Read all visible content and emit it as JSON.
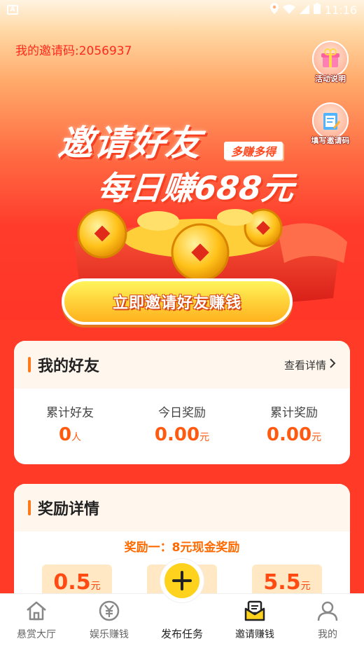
{
  "status_bar": {
    "time": "11:16"
  },
  "hero": {
    "invite_code": "我的邀请码:2056937",
    "side_buttons": [
      {
        "label": "活动说明",
        "icon": "gift-icon"
      },
      {
        "label": "填写邀请码",
        "icon": "clipboard-edit-icon"
      }
    ],
    "headline_line1": "邀请好友",
    "headline_tag": "多赚多得",
    "headline_line2": "每日赚688元",
    "invite_button": "立即邀请好友赚钱"
  },
  "friends_card": {
    "title": "我的好友",
    "more": "查看详情",
    "stats": [
      {
        "label": "累计好友",
        "value": "0",
        "unit": "人"
      },
      {
        "label": "今日奖励",
        "value": "0.00",
        "unit": "元"
      },
      {
        "label": "累计奖励",
        "value": "0.00",
        "unit": "元"
      }
    ]
  },
  "reward_card": {
    "title": "奖励详情",
    "subtitle_prefix": "奖励一：",
    "subtitle_highlight": "8元现金奖励",
    "tickets": [
      {
        "value": "0.5",
        "unit": "元"
      },
      {
        "value": "",
        "unit": ""
      },
      {
        "value": "5.5",
        "unit": "元"
      }
    ]
  },
  "bottom_nav": [
    {
      "label": "悬赏大厅",
      "icon": "home-icon"
    },
    {
      "label": "娱乐赚钱",
      "icon": "yuan-coin-icon"
    },
    {
      "label": "发布任务",
      "icon": "plus-icon"
    },
    {
      "label": "邀请赚钱",
      "icon": "envelope-icon"
    },
    {
      "label": "我的",
      "icon": "user-icon"
    }
  ],
  "colors": {
    "accent": "#ff3a27",
    "orange": "#ff6a00",
    "yellow": "#ffd21e"
  }
}
